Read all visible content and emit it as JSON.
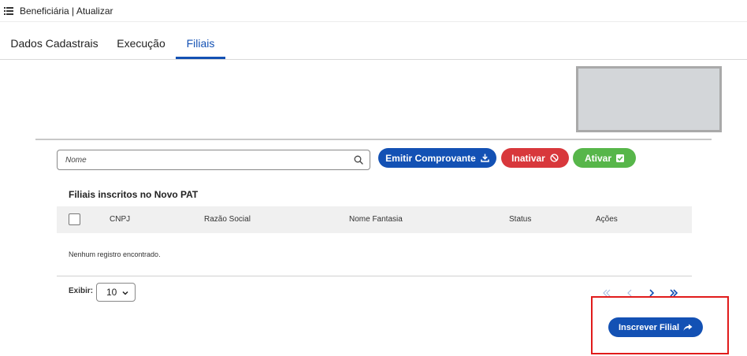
{
  "header": {
    "title": "Beneficiária | Atualizar"
  },
  "tabs": [
    {
      "label": "Dados Cadastrais",
      "active": false
    },
    {
      "label": "Execução",
      "active": false
    },
    {
      "label": "Filiais",
      "active": true
    }
  ],
  "toolbar": {
    "search_placeholder": "Nome",
    "emit_label": "Emitir Comprovante",
    "inactivate_label": "Inativar",
    "activate_label": "Ativar"
  },
  "table": {
    "title": "Filiais inscritos no Novo PAT",
    "columns": [
      "CNPJ",
      "Razão Social",
      "Nome Fantasia",
      "Status",
      "Ações"
    ],
    "empty_message": "Nenhum registro encontrado."
  },
  "pagination": {
    "show_label": "Exibir:",
    "page_size": "10"
  },
  "actions": {
    "enroll_label": "Inscrever Filial"
  },
  "colors": {
    "primary": "#1351b4",
    "danger": "#d8383c",
    "success": "#57b64a",
    "highlight": "#e11b1b"
  }
}
